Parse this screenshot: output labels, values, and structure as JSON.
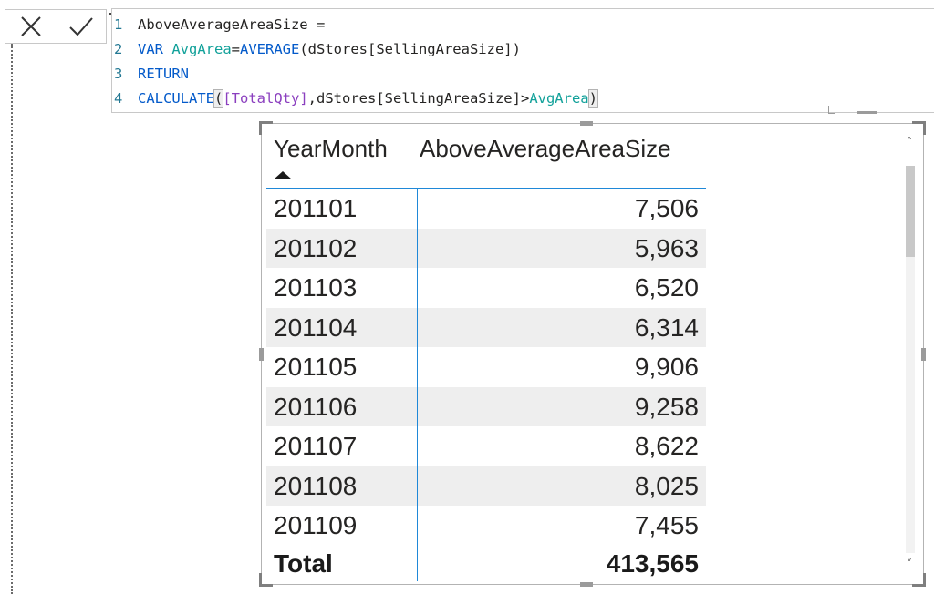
{
  "formula_bar": {
    "cancel_icon": "close-icon",
    "commit_icon": "check-icon",
    "lines": [
      {
        "num": "1",
        "tokens": [
          {
            "t": "AboveAverageAreaSize = ",
            "c": "plain"
          }
        ]
      },
      {
        "num": "2",
        "tokens": [
          {
            "t": "VAR ",
            "c": "kw"
          },
          {
            "t": "AvgArea",
            "c": "var"
          },
          {
            "t": "=",
            "c": "plain"
          },
          {
            "t": "AVERAGE",
            "c": "fn"
          },
          {
            "t": "(dStores[SellingAreaSize])",
            "c": "plain"
          }
        ]
      },
      {
        "num": "3",
        "tokens": [
          {
            "t": "RETURN",
            "c": "kw"
          }
        ]
      },
      {
        "num": "4",
        "tokens": [
          {
            "t": "CALCULATE",
            "c": "fn"
          },
          {
            "t": "(",
            "c": "paren"
          },
          {
            "t": "[TotalQty]",
            "c": "meas"
          },
          {
            "t": ",dStores[SellingAreaSize]>",
            "c": "plain"
          },
          {
            "t": "AvgArea",
            "c": "var"
          },
          {
            "t": ")",
            "c": "paren"
          }
        ]
      }
    ]
  },
  "table": {
    "headers": {
      "year_month": "YearMonth",
      "measure": "AboveAverageAreaSize"
    },
    "sort_icon": "sort-ascending-icon",
    "rows": [
      {
        "ym": "201101",
        "val": "7,506"
      },
      {
        "ym": "201102",
        "val": "5,963"
      },
      {
        "ym": "201103",
        "val": "6,520"
      },
      {
        "ym": "201104",
        "val": "6,314"
      },
      {
        "ym": "201105",
        "val": "9,906"
      },
      {
        "ym": "201106",
        "val": "9,258"
      },
      {
        "ym": "201107",
        "val": "8,622"
      },
      {
        "ym": "201108",
        "val": "8,025"
      },
      {
        "ym": "201109",
        "val": "7,455"
      }
    ],
    "total": {
      "label": "Total",
      "val": "413,565"
    }
  },
  "scrollbar": {
    "up": "˄",
    "down": "˅"
  }
}
